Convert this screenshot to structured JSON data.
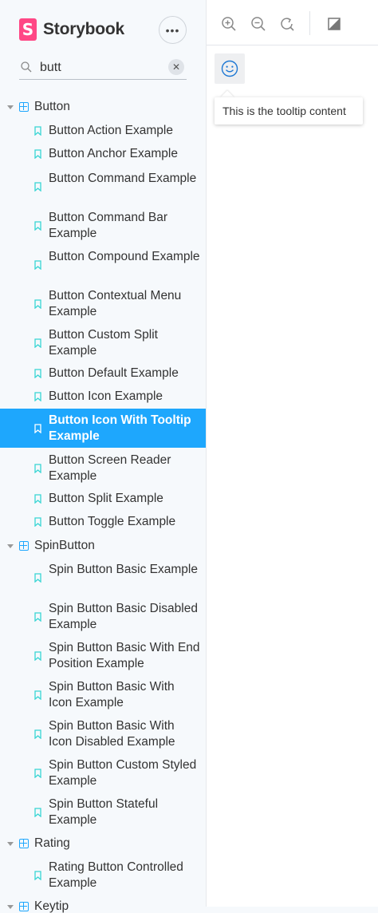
{
  "brand": {
    "name": "Storybook",
    "logo_letter": "S"
  },
  "search": {
    "value": "butt",
    "placeholder": ""
  },
  "groups": [
    {
      "label": "Button",
      "icon": "component-icon"
    },
    {
      "label": "SpinButton",
      "icon": "component-icon"
    },
    {
      "label": "Rating",
      "icon": "component-icon"
    },
    {
      "label": "Keytip",
      "icon": "component-icon"
    }
  ],
  "button_stories": [
    "Button Action Example",
    "Button Anchor Example",
    "Button Command Example",
    "Button Command Bar Example",
    "Button Compound Example",
    "Button Contextual Menu Example",
    "Button Custom Split Example",
    "Button Default Example",
    "Button Icon Example",
    "Button Icon With Tooltip Example",
    "Button Screen Reader Example",
    "Button Split Example",
    "Button Toggle Example"
  ],
  "spin_stories": [
    "Spin Button Basic Example",
    "Spin Button Basic Disabled Example",
    "Spin Button Basic With End Position Example",
    "Spin Button Basic With Icon Example",
    "Spin Button Basic With Icon Disabled Example",
    "Spin Button Custom Styled Example",
    "Spin Button Stateful Example"
  ],
  "rating_stories": [
    "Rating Button Controlled Example"
  ],
  "selected_story": "Button Icon With Tooltip Example",
  "toolbar": {
    "zoom_in": "zoom-in-icon",
    "zoom_out": "zoom-out-icon",
    "zoom_reset": "zoom-reset-icon",
    "background": "background-icon"
  },
  "preview": {
    "tooltip_text": "This is the tooltip content"
  },
  "colors": {
    "accent": "#1ea7fd",
    "brand": "#ff4785",
    "bookmark": "#37d5d3"
  }
}
